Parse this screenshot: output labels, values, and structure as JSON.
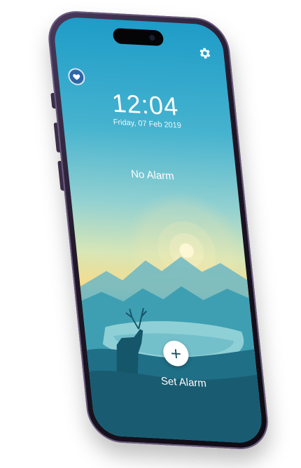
{
  "top_bar": {
    "settings_icon": "gear-icon",
    "badge_icon": "heart-badge-icon"
  },
  "clock": {
    "time": "12:04",
    "date": "Friday, 07 Feb 2019"
  },
  "alarm": {
    "status": "No Alarm"
  },
  "actions": {
    "add_icon_glyph": "+",
    "set_alarm_label": "Set Alarm"
  },
  "colors": {
    "sky_top": "#1e9cc8",
    "sun_glow": "#f4dc8c",
    "lake": "#1a6379",
    "badge_blue": "#2f66a6",
    "frame": "#1e1626"
  }
}
